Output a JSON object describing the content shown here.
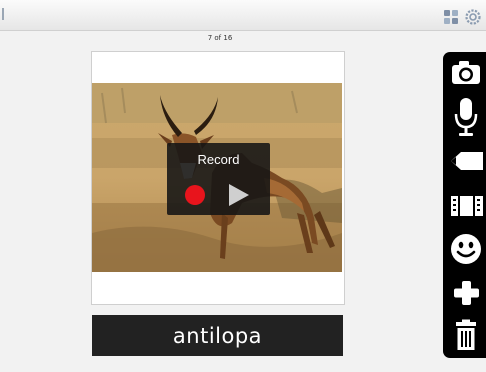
{
  "header": {
    "left_icon": "back-glyph-icon",
    "right_icons": [
      "apps-icon",
      "settings-icon"
    ]
  },
  "page": {
    "counter": "7 of 16"
  },
  "card": {
    "image": "impala-antelope-photo",
    "caption": "antilopa"
  },
  "recorder": {
    "title": "Record",
    "record_icon": "record-icon",
    "play_icon": "play-icon",
    "record_color": "#e8141c"
  },
  "toolbar": {
    "tools": [
      "camera-icon",
      "microphone-icon",
      "pencil-icon",
      "film-icon",
      "smiley-icon",
      "plus-icon",
      "trash-icon"
    ]
  }
}
